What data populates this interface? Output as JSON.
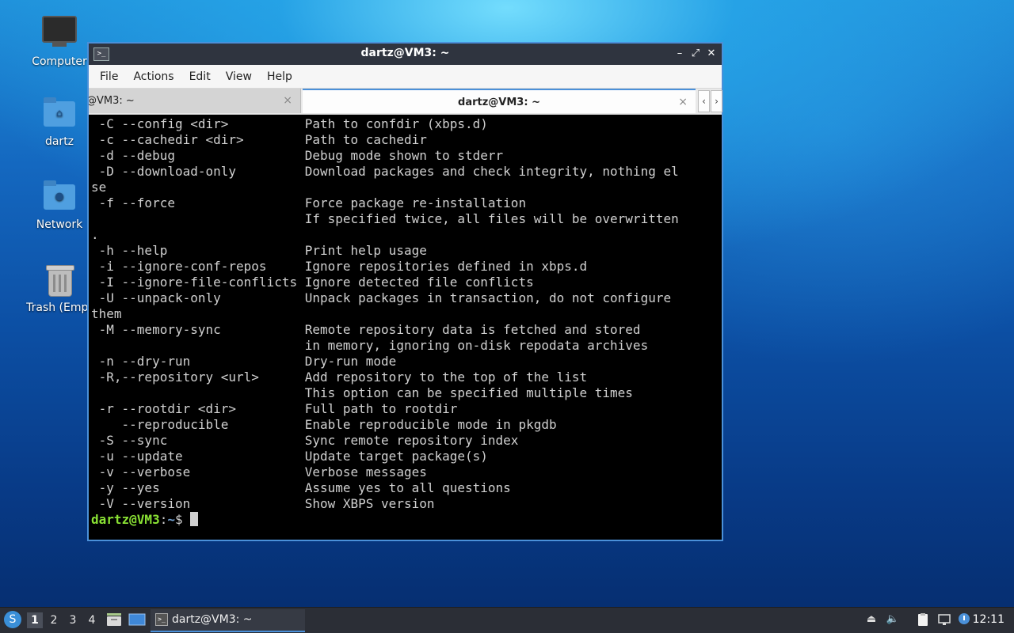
{
  "desktop": {
    "icons": [
      {
        "label": "Computer"
      },
      {
        "label": "dartz"
      },
      {
        "label": "Network"
      },
      {
        "label": "Trash (Empt"
      }
    ]
  },
  "window": {
    "title": "dartz@VM3: ~",
    "controls": {
      "minimize": "–",
      "maximize": "⤢",
      "close": "✕"
    },
    "menu": [
      "File",
      "Actions",
      "Edit",
      "View",
      "Help"
    ],
    "tabs": [
      {
        "label": "@VM3: ~",
        "close": "×"
      },
      {
        "label": "dartz@VM3: ~",
        "close": "×"
      }
    ],
    "scroll_left": "‹",
    "scroll_right": "›"
  },
  "terminal": {
    "lines": [
      " -C --config <dir>          Path to confdir (xbps.d)",
      " -c --cachedir <dir>        Path to cachedir",
      " -d --debug                 Debug mode shown to stderr",
      " -D --download-only         Download packages and check integrity, nothing el",
      "se",
      " -f --force                 Force package re-installation",
      "                            If specified twice, all files will be overwritten",
      ".",
      " -h --help                  Print help usage",
      " -i --ignore-conf-repos     Ignore repositories defined in xbps.d",
      " -I --ignore-file-conflicts Ignore detected file conflicts",
      " -U --unpack-only           Unpack packages in transaction, do not configure",
      "them",
      " -M --memory-sync           Remote repository data is fetched and stored",
      "                            in memory, ignoring on-disk repodata archives",
      " -n --dry-run               Dry-run mode",
      " -R,--repository <url>      Add repository to the top of the list",
      "                            This option can be specified multiple times",
      " -r --rootdir <dir>         Full path to rootdir",
      "    --reproducible          Enable reproducible mode in pkgdb",
      " -S --sync                  Sync remote repository index",
      " -u --update                Update target package(s)",
      " -v --verbose               Verbose messages",
      " -y --yes                   Assume yes to all questions",
      " -V --version               Show XBPS version"
    ],
    "prompt": {
      "user": "dartz@VM3",
      "colon": ":",
      "path": "~",
      "symbol": "$ "
    }
  },
  "taskbar": {
    "start_icon": "void-logo-icon",
    "workspaces": [
      "1",
      "2",
      "3",
      "4"
    ],
    "active_workspace": "1",
    "task_label": "dartz@VM3: ~",
    "clock": "12:11"
  },
  "colors": {
    "accent": "#4a90d9",
    "prompt_user": "#8ae234",
    "prompt_path": "#729fcf"
  }
}
